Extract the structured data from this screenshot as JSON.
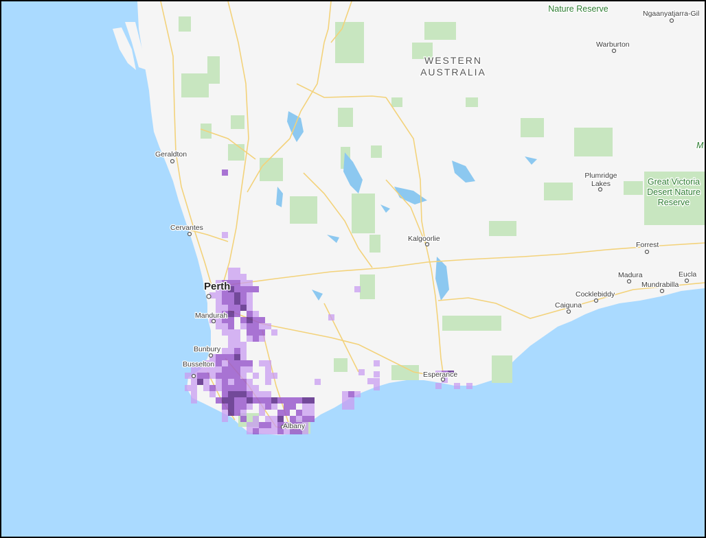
{
  "map": {
    "colors": {
      "ocean": "#aadaff",
      "land": "#f5f5f5",
      "park": "#c8e6c0",
      "water": "#8cc8f0",
      "road": "#f3d27a",
      "occurrence_light": "#c89cf0",
      "occurrence_mid": "#9a5ccc",
      "occurrence_dark": "#5a2a88"
    },
    "region_label_line1": "WESTERN",
    "region_label_line2": "AUSTRALIA",
    "places": {
      "geraldton": "Geraldton",
      "cervantes": "Cervantes",
      "perth": "Perth",
      "mandurah": "Mandurah",
      "bunbury": "Bunbury",
      "busselton": "Busselton",
      "albany": "Albany",
      "esperance": "Esperance",
      "kalgoorlie": "Kalgoorlie",
      "warburton": "Warburton",
      "ngaanyatjarra": "Ngaanyatjarra-Gil",
      "plumridge_line1": "Plumridge",
      "plumridge_line2": "Lakes",
      "forrest": "Forrest",
      "madura": "Madura",
      "eucla": "Eucla",
      "mundrabilla": "Mundrabilla",
      "cocklebiddy": "Cocklebiddy",
      "caiguna": "Caiguna"
    },
    "parks": {
      "nature_reserve": "Nature Reserve",
      "great_victoria_line1": "Great Victoria",
      "great_victoria_line2": "Desert Nature",
      "great_victoria_line3": "Reserve",
      "edge_m": "M"
    }
  }
}
